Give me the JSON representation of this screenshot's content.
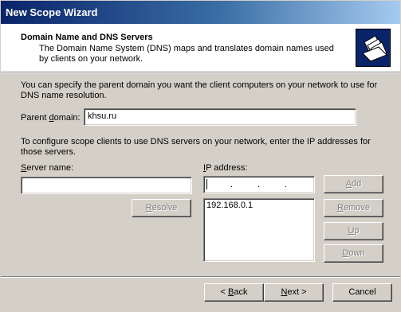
{
  "window": {
    "title": "New Scope Wizard"
  },
  "header": {
    "title": "Domain Name and DNS Servers",
    "description": "The Domain Name System (DNS) maps and translates domain names used by clients on your network.",
    "icon": "folders-icon"
  },
  "parent_domain": {
    "intro": "You can specify the parent domain you want the client computers on your network to use for DNS name resolution.",
    "label_pre": "Parent ",
    "label_u": "d",
    "label_post": "omain:",
    "value": "khsu.ru"
  },
  "dns": {
    "intro": "To configure scope clients to use DNS servers on your network, enter the IP addresses for those servers.",
    "server_label_u": "S",
    "server_label_post": "erver name:",
    "server_value": "",
    "ip_label_pre": "",
    "ip_label_u": "I",
    "ip_label_post": "P address:",
    "ip_dots": [
      ".",
      ".",
      "."
    ],
    "ip_list": [
      "192.168.0.1"
    ],
    "buttons": {
      "resolve": {
        "u": "R",
        "rest": "esolve"
      },
      "add": {
        "u": "A",
        "rest": "dd"
      },
      "remove": {
        "u": "R",
        "rest": "emove"
      },
      "up": {
        "u": "U",
        "rest": "p"
      },
      "down": {
        "u": "D",
        "rest": "own"
      }
    }
  },
  "footer": {
    "back": {
      "pre": "< ",
      "u": "B",
      "rest": "ack"
    },
    "next": {
      "pre": "",
      "u": "N",
      "rest": "ext >"
    },
    "cancel": "Cancel"
  }
}
